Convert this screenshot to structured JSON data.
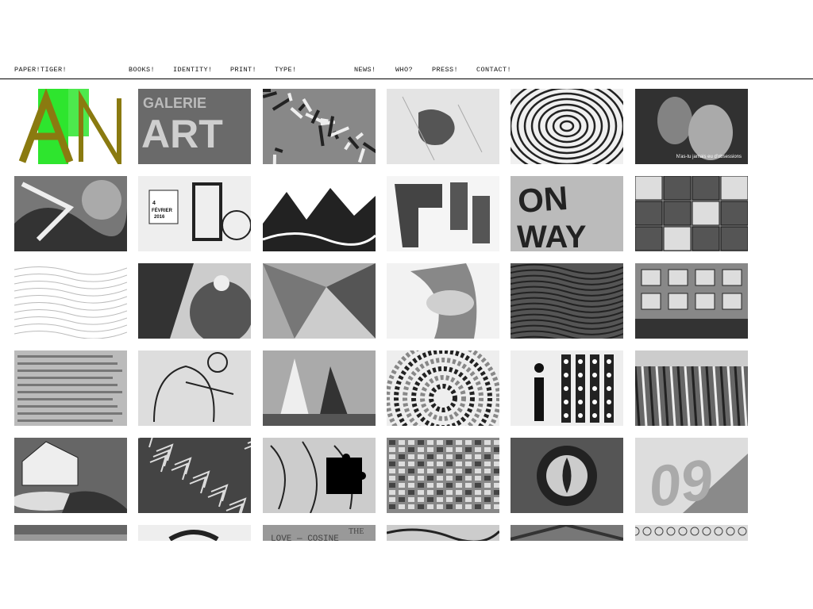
{
  "nav": {
    "logo": "PAPER!TIGER!",
    "items": [
      {
        "label": "BOOKS!"
      },
      {
        "label": "IDENTITY!"
      },
      {
        "label": "PRINT!"
      },
      {
        "label": "TYPE!"
      },
      {
        "label": "NEWS!"
      },
      {
        "label": "WHO?"
      },
      {
        "label": "PRESS!"
      },
      {
        "label": "CONTACT!"
      }
    ]
  },
  "colors": {
    "accent_green": "#2ee52e",
    "accent_olive": "#8a7a10",
    "tile_gray": "#9a9a9a"
  },
  "tiles": [
    {
      "name": "an-green-letters",
      "text": "AN"
    },
    {
      "name": "galerie-art-sign",
      "text": "ARRIE ART"
    },
    {
      "name": "pattern-squiggles"
    },
    {
      "name": "crumpled-paper"
    },
    {
      "name": "contour-lines"
    },
    {
      "name": "film-still-kiss",
      "caption": "N'as-tu jamais eu d'obsessions"
    },
    {
      "name": "abstract-shapes"
    },
    {
      "name": "calendar-illustration",
      "text": "4 FÉVRIER 2016"
    },
    {
      "name": "mountain-illustration"
    },
    {
      "name": "fragment-letters"
    },
    {
      "name": "one-way-type",
      "text": "WAY"
    },
    {
      "name": "comic-collage"
    },
    {
      "name": "topographic-lines"
    },
    {
      "name": "geometric-photo"
    },
    {
      "name": "faceted-shapes"
    },
    {
      "name": "hands-fabric"
    },
    {
      "name": "wave-lines"
    },
    {
      "name": "gallery-interior"
    },
    {
      "name": "text-page",
      "text": "prodigieux, deroit alors la vie"
    },
    {
      "name": "figure-drawing"
    },
    {
      "name": "sailboat-collage"
    },
    {
      "name": "circular-mosaic"
    },
    {
      "name": "dotted-letters",
      "text": "i"
    },
    {
      "name": "graffiti-photo"
    },
    {
      "name": "house-drawing"
    },
    {
      "name": "dark-collage"
    },
    {
      "name": "puzzle-illustration"
    },
    {
      "name": "tower-block"
    },
    {
      "name": "eye-emblem"
    },
    {
      "name": "number-09",
      "text": "09"
    },
    {
      "name": "partial-tile-1"
    },
    {
      "name": "partial-tile-2"
    },
    {
      "name": "love-cosine",
      "text": "LOVE — COSINE THE"
    },
    {
      "name": "partial-tile-4"
    },
    {
      "name": "partial-tile-5"
    },
    {
      "name": "partial-tile-6"
    }
  ]
}
